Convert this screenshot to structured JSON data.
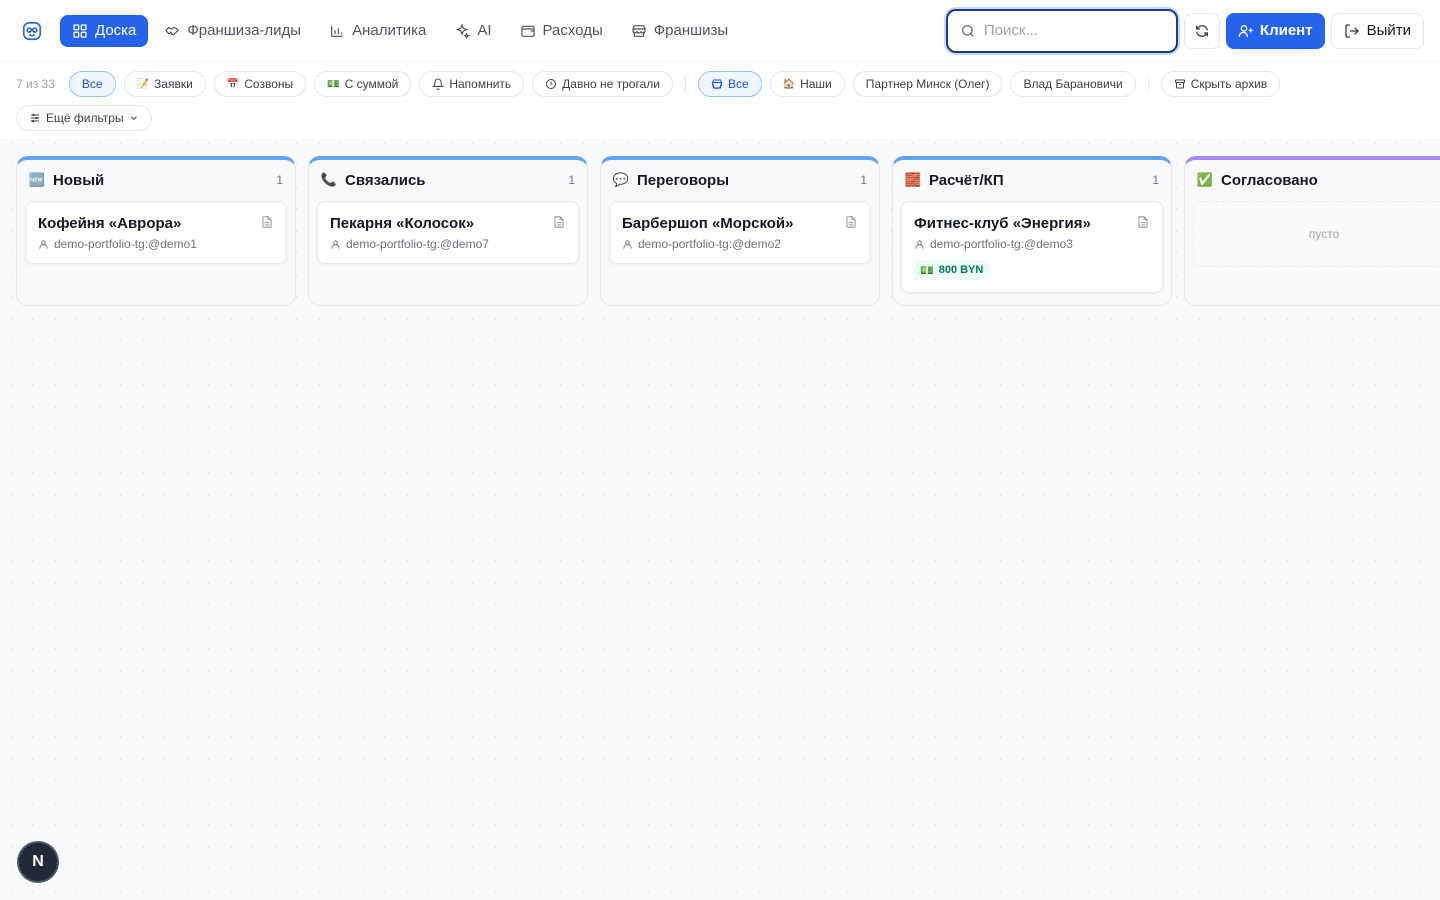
{
  "nav": {
    "items": [
      {
        "label": "Доска",
        "icon": "grid-icon"
      },
      {
        "label": "Франшиза-лиды",
        "icon": "handshake-icon"
      },
      {
        "label": "Аналитика",
        "icon": "bar-chart-icon"
      },
      {
        "label": "AI",
        "icon": "sparkles-icon"
      },
      {
        "label": "Расходы",
        "icon": "wallet-icon"
      },
      {
        "label": "Франшизы",
        "icon": "store-icon"
      }
    ],
    "search_placeholder": "Поиск...",
    "client_button": "Клиент",
    "logout_button": "Выйти"
  },
  "filters": {
    "count": "7 из 33",
    "type_chips": [
      {
        "label": "Все",
        "emoji": "",
        "active": true
      },
      {
        "label": "Заявки",
        "emoji": "📝",
        "active": false
      },
      {
        "label": "Созвоны",
        "emoji": "📅",
        "active": false
      },
      {
        "label": "С суммой",
        "emoji": "💵",
        "active": false
      },
      {
        "label": "Напомнить",
        "emoji": "",
        "active": false
      },
      {
        "label": "Давно не трогали",
        "emoji": "",
        "active": false
      }
    ],
    "owner_chips": [
      {
        "label": "Все",
        "active": true
      },
      {
        "label": "Наши",
        "emoji": "🏠"
      },
      {
        "label": "Партнер Минск (Олег)"
      },
      {
        "label": "Влад Барановичи"
      }
    ],
    "archive_chip": "Скрыть архив",
    "more_filters": "Ещё фильтры"
  },
  "board": {
    "columns": [
      {
        "title": "Новый",
        "emoji": "🆕",
        "count": "1",
        "card": {
          "title": "Кофейня «Аврора»",
          "owner": "demo-portfolio-tg:@demo1"
        }
      },
      {
        "title": "Связались",
        "emoji": "📞",
        "count": "1",
        "card": {
          "title": "Пекарня «Колосок»",
          "owner": "demo-portfolio-tg:@demo7"
        }
      },
      {
        "title": "Переговоры",
        "emoji": "💬",
        "count": "1",
        "card": {
          "title": "Барбершоп «Морской»",
          "owner": "demo-portfolio-tg:@demo2"
        }
      },
      {
        "title": "Расчёт/КП",
        "emoji": "🧱",
        "count": "1",
        "card": {
          "title": "Фитнес-клуб «Энергия»",
          "owner": "demo-portfolio-tg:@demo3",
          "amount": "800 BYN",
          "amount_emoji": "💵"
        }
      },
      {
        "title": "Согласовано",
        "emoji": "✅",
        "count": "0",
        "empty_label": "пусто"
      }
    ]
  },
  "badge": "N",
  "colors": {
    "accent": "#2563eb",
    "column_top": "#60a5fa",
    "column_top_done": "#a78bfa"
  }
}
